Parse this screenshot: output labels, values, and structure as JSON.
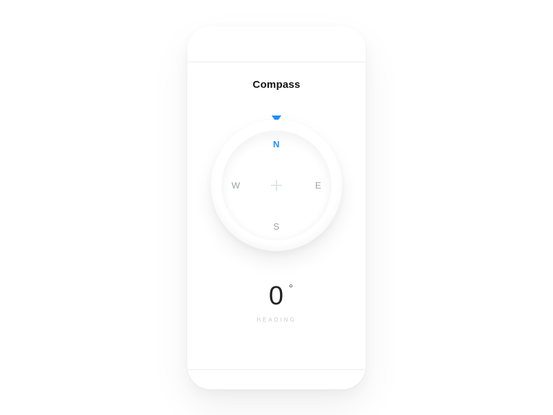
{
  "title": "Compass",
  "directions": {
    "n": "N",
    "e": "E",
    "s": "S",
    "w": "W"
  },
  "heading": {
    "value": "0",
    "degree_symbol": "°",
    "label": "HEADING"
  },
  "colors": {
    "accent": "#1f8fff"
  }
}
